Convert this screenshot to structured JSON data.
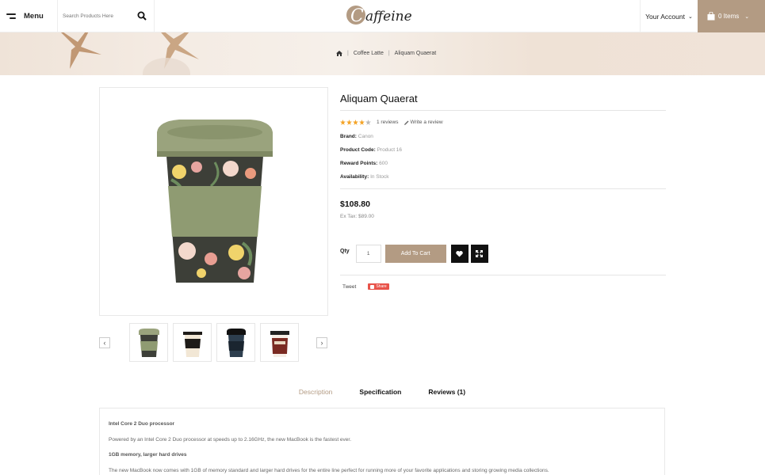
{
  "header": {
    "menu_label": "Menu",
    "search_placeholder": "Search Products Here",
    "logo_text": "Caffeine",
    "account_label": "Your Account",
    "cart_label": "0 Items"
  },
  "breadcrumb": [
    "Coffee Latte",
    "Aliquam Quaerat"
  ],
  "product": {
    "title": "Aliquam Quaerat",
    "rating": 4,
    "rating_max": 5,
    "reviews_link": "1 reviews",
    "write_review": "Write a review",
    "specs": [
      {
        "label": "Brand:",
        "value": "Canon"
      },
      {
        "label": "Product Code:",
        "value": "Product 16"
      },
      {
        "label": "Reward Points:",
        "value": "600"
      },
      {
        "label": "Availability:",
        "value": "In Stock"
      }
    ],
    "price": "$108.80",
    "ex_tax": "Ex Tax: $89.00",
    "qty_label": "Qty",
    "qty_value": "1",
    "add_to_cart": "Add To Cart",
    "tweet": "Tweet",
    "share": "Share"
  },
  "tabs": [
    {
      "label": "Description",
      "active": true
    },
    {
      "label": "Specification",
      "active": false
    },
    {
      "label": "Reviews (1)",
      "active": false
    }
  ],
  "description": {
    "heading1": "Intel Core 2 Duo processor",
    "para1": "Powered by an Intel Core 2 Duo processor at speeds up to 2.16GHz, the new MacBook is the fastest ever.",
    "heading2": "1GB memory, larger hard drives",
    "para2": "The new MacBook now comes with 1GB of memory standard and larger hard drives for the entire line perfect for running more of your favorite applications and storing growing media collections."
  },
  "colors": {
    "accent": "#b39b83",
    "star": "#f4a428",
    "share": "#e8534a",
    "cup_sleeve": "#8f9b72",
    "cup_body": "#3d3f38"
  }
}
